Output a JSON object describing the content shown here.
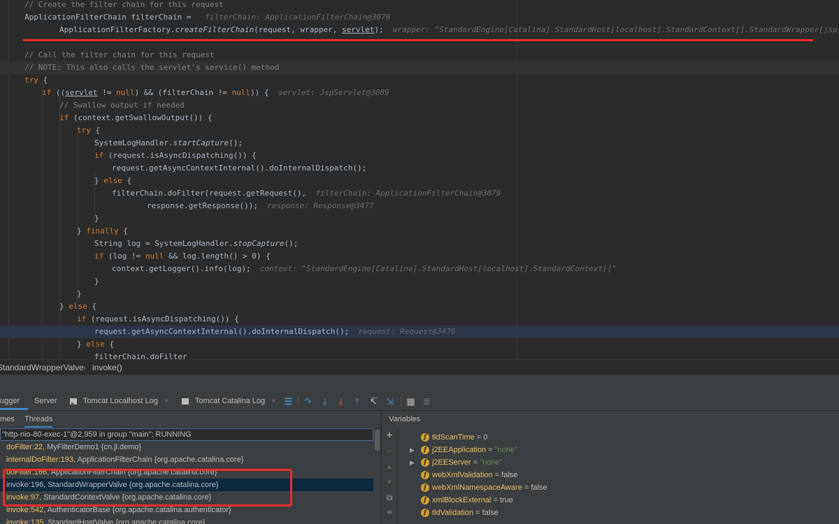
{
  "editor": {
    "lines": [
      {
        "indent": 35,
        "segs": [
          [
            "c",
            "// Create the filter chain for this request"
          ]
        ]
      },
      {
        "indent": 35,
        "segs": [
          [
            "t",
            "ApplicationFilterChain filterChain = "
          ],
          [
            "h",
            "  filterChain: ApplicationFilterChain@3079"
          ]
        ]
      },
      {
        "indent": 85,
        "segs": [
          [
            "t",
            "ApplicationFilterFactory."
          ],
          [
            "i",
            "createFilterChain"
          ],
          [
            "t",
            "(request, wrapper, "
          ],
          [
            "u",
            "servlet"
          ],
          [
            "t",
            ");"
          ],
          [
            "h",
            "  wrapper: \"StandardEngine[Catalina].StandardHost[localhost].StandardContext[].StandardWrapper[jsp]\""
          ]
        ]
      },
      {
        "indent": 35,
        "segs": []
      },
      {
        "indent": 35,
        "segs": [
          [
            "c",
            "// Call the filter chain for this request"
          ]
        ]
      },
      {
        "indent": 35,
        "segs": [
          [
            "c",
            "// NOTE: This also calls the servlet's service() method"
          ]
        ]
      },
      {
        "indent": 35,
        "segs": [
          [
            "k",
            "try"
          ],
          [
            "t",
            " {"
          ]
        ]
      },
      {
        "indent": 60,
        "segs": [
          [
            "k",
            "if"
          ],
          [
            "t",
            " (("
          ],
          [
            "u",
            "servlet"
          ],
          [
            "t",
            " != "
          ],
          [
            "k",
            "null"
          ],
          [
            "t",
            ") && (filterChain != "
          ],
          [
            "k",
            "null"
          ],
          [
            "t",
            ")) {"
          ],
          [
            "h",
            "  servlet: JspServlet@3089"
          ]
        ]
      },
      {
        "indent": 85,
        "segs": [
          [
            "c",
            "// Swallow output if needed"
          ]
        ]
      },
      {
        "indent": 85,
        "segs": [
          [
            "k",
            "if"
          ],
          [
            "t",
            " (context.getSwallowOutput()) {"
          ]
        ]
      },
      {
        "indent": 110,
        "segs": [
          [
            "k",
            "try"
          ],
          [
            "t",
            " {"
          ]
        ]
      },
      {
        "indent": 135,
        "segs": [
          [
            "t",
            "SystemLogHandler."
          ],
          [
            "i",
            "startCapture"
          ],
          [
            "t",
            "();"
          ]
        ]
      },
      {
        "indent": 135,
        "segs": [
          [
            "k",
            "if"
          ],
          [
            "t",
            " (request.isAsyncDispatching()) {"
          ]
        ]
      },
      {
        "indent": 160,
        "segs": [
          [
            "t",
            "request.getAsyncContextInternal().doInternalDispatch();"
          ]
        ]
      },
      {
        "indent": 135,
        "segs": [
          [
            "t",
            "} "
          ],
          [
            "k",
            "else"
          ],
          [
            "t",
            " {"
          ]
        ]
      },
      {
        "indent": 160,
        "segs": [
          [
            "t",
            "filterChain.doFilter(request.getRequest(),"
          ],
          [
            "h",
            "  filterChain: ApplicationFilterChain@3079"
          ]
        ]
      },
      {
        "indent": 210,
        "segs": [
          [
            "t",
            "response.getResponse());"
          ],
          [
            "h",
            "  response: Response@3477"
          ]
        ]
      },
      {
        "indent": 135,
        "segs": [
          [
            "t",
            "}"
          ]
        ]
      },
      {
        "indent": 110,
        "segs": [
          [
            "t",
            "} "
          ],
          [
            "k",
            "finally"
          ],
          [
            "t",
            " {"
          ]
        ]
      },
      {
        "indent": 135,
        "segs": [
          [
            "t",
            "String log = SystemLogHandler."
          ],
          [
            "i",
            "stopCapture"
          ],
          [
            "t",
            "();"
          ]
        ]
      },
      {
        "indent": 135,
        "segs": [
          [
            "k",
            "if"
          ],
          [
            "t",
            " (log != "
          ],
          [
            "k",
            "null"
          ],
          [
            "t",
            " && log.length() > "
          ],
          [
            "t",
            "0"
          ],
          [
            "t",
            ") {"
          ]
        ]
      },
      {
        "indent": 160,
        "segs": [
          [
            "t",
            "context.getLogger().info(log);"
          ],
          [
            "h",
            "  context: \"StandardEngine[Catalina].StandardHost[localhost].StandardContext[]\""
          ]
        ]
      },
      {
        "indent": 135,
        "segs": [
          [
            "t",
            "}"
          ]
        ]
      },
      {
        "indent": 110,
        "segs": [
          [
            "t",
            "}"
          ]
        ]
      },
      {
        "indent": 85,
        "segs": [
          [
            "t",
            "} "
          ],
          [
            "k",
            "else"
          ],
          [
            "t",
            " {"
          ]
        ]
      },
      {
        "indent": 110,
        "segs": [
          [
            "k",
            "if"
          ],
          [
            "t",
            " (request.isAsyncDispatching()) {"
          ]
        ]
      },
      {
        "indent": 135,
        "segs": [
          [
            "t",
            "request.getAsyncContextInternal().doInternalDispatch();"
          ],
          [
            "h",
            "  request: Request@3476"
          ]
        ]
      },
      {
        "indent": 110,
        "segs": [
          [
            "t",
            "} "
          ],
          [
            "k",
            "else"
          ],
          [
            "t",
            " {"
          ]
        ]
      },
      {
        "indent": 135,
        "segs": [
          [
            "t",
            "filterChain.doFilter"
          ]
        ]
      }
    ],
    "highlighted_line": 5,
    "execution_line": 26
  },
  "breadcrumb": {
    "class": "StandardWrapperValve",
    "separator": "›",
    "method": "invoke()"
  },
  "debug_toolbar": {
    "tabs": [
      {
        "label": "Debugger",
        "visible": "ugger",
        "active": true
      },
      {
        "label": "Server"
      },
      {
        "label": "Tomcat Localhost Log",
        "closable": true
      },
      {
        "label": "Tomcat Catalina Log",
        "closable": true
      }
    ],
    "close_glyph": "×"
  },
  "frames": {
    "tabs": [
      {
        "visible": "mes",
        "active": false
      },
      {
        "label": "Threads",
        "active": true
      }
    ],
    "thread": "\"http-nio-80-exec-1\"@2,959 in group \"main\": RUNNING",
    "rows": [
      {
        "method": "doFilter:22,",
        "place": "MyFilterDemo1 {cn.jl.demo}"
      },
      {
        "method": "internalDoFilter:193,",
        "place": "ApplicationFilterChain {org.apache.catalina.core}"
      },
      {
        "method": "doFilter:166,",
        "place": "ApplicationFilterChain {org.apache.catalina.core}"
      },
      {
        "method": "invoke:196,",
        "place": "StandardWrapperValve {org.apache.catalina.core}",
        "selected": true
      },
      {
        "method": "invoke:97,",
        "place": "StandardContextValve {org.apache.catalina.core}"
      },
      {
        "method": "invoke:542,",
        "place": "AuthenticatorBase {org.apache.catalina.authenticator}"
      },
      {
        "method": "invoke:135,",
        "place": "StandardHostValve {org.apache.catalina.core}"
      }
    ]
  },
  "variables": {
    "title": "Variables",
    "rows": [
      {
        "name": "tldScanTime",
        "value": "0",
        "string": false,
        "expandable": false
      },
      {
        "name": "j2EEApplication",
        "value": "\"none\"",
        "string": true,
        "expandable": true
      },
      {
        "name": "j2EEServer",
        "value": "\"none\"",
        "string": true,
        "expandable": true
      },
      {
        "name": "webXmlValidation",
        "value": "false",
        "string": false,
        "expandable": false
      },
      {
        "name": "webXmlNamespaceAware",
        "value": "false",
        "string": false,
        "expandable": false
      },
      {
        "name": "xmlBlockExternal",
        "value": "true",
        "string": false,
        "expandable": false
      },
      {
        "name": "tldValidation",
        "value": "false",
        "string": false,
        "expandable": false
      }
    ],
    "field_badge": "f",
    "equals": " = "
  },
  "colors": {
    "annotation_red": "#ef2d2d",
    "selection": "#0d293e",
    "execution_line": "#2d3548",
    "keyword": "#cc7832",
    "comment": "#808080",
    "method_frame": "#e8bf6a",
    "string_value": "#6a8759"
  }
}
